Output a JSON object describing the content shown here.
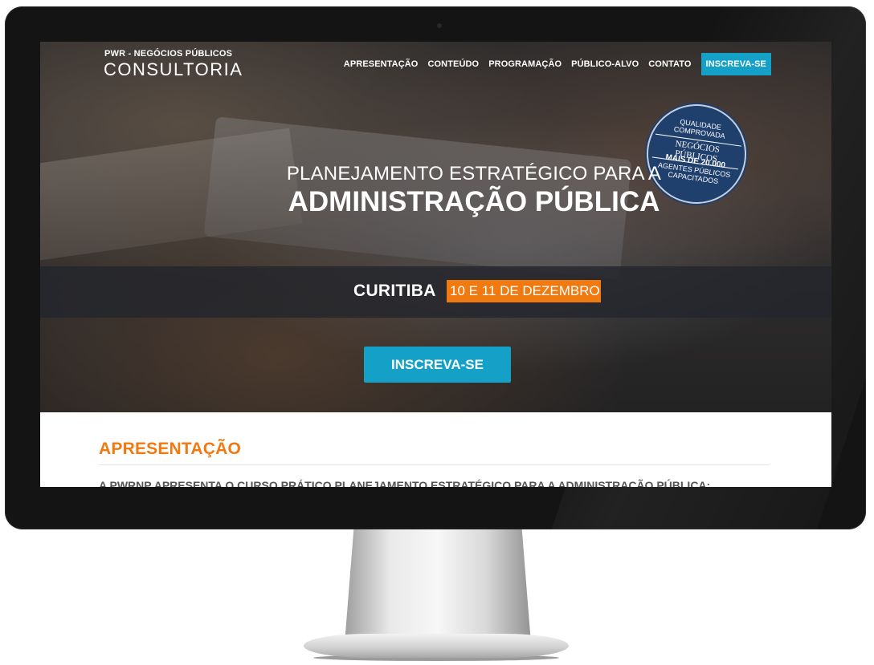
{
  "brand": {
    "top": "PWR - NEGÓCIOS PÚBLICOS",
    "main": "CONSULTORIA"
  },
  "nav": {
    "items": [
      {
        "label": "APRESENTAÇÃO"
      },
      {
        "label": "CONTEÚDO"
      },
      {
        "label": "PROGRAMAÇÃO"
      },
      {
        "label": "PÚBLICO-ALVO"
      },
      {
        "label": "CONTATO"
      }
    ],
    "cta": "INSCREVA-SE"
  },
  "hero": {
    "line1": "PLANEJAMENTO ESTRATÉGICO PARA A",
    "line2": "ADMINISTRAÇÃO PÚBLICA",
    "city": "CURITIBA",
    "date": "10 E 11 DE DEZEMBRO",
    "cta": "INSCREVA-SE"
  },
  "seal": {
    "line1": "QUALIDADE",
    "line2": "COMPROVADA",
    "brand": "NEGÓCIOS PÚBLICOS",
    "line3": "MAIS DE 20.000",
    "line4": "AGENTES PÚBLICOS",
    "line5": "CAPACITADOS"
  },
  "section": {
    "title": "APRESENTAÇÃO",
    "text": "A PWRNP APRESENTA O CURSO PRÁTICO PLANEJAMENTO ESTRATÉGICO PARA A ADMINISTRAÇÃO PÚBLICA:"
  },
  "colors": {
    "accent_orange": "#f07a10",
    "accent_blue": "#15a0c8",
    "seal_blue": "#1f3f6d"
  }
}
